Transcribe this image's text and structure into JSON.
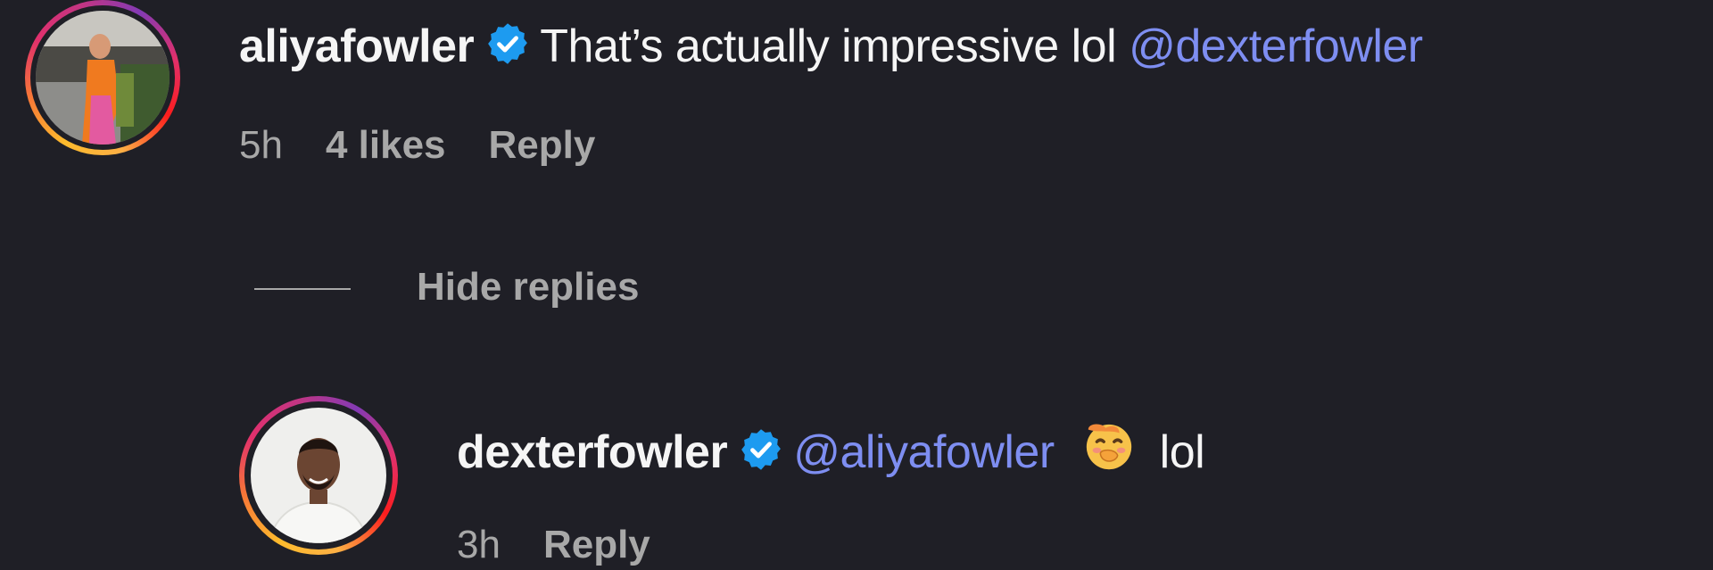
{
  "comments": [
    {
      "username": "aliyafowler",
      "verified": true,
      "text": "That’s actually impressive lol",
      "mention": "@dexterfowler",
      "time": "5h",
      "likes": "4 likes",
      "reply_label": "Reply"
    }
  ],
  "hide_replies_label": "Hide replies",
  "replies": [
    {
      "username": "dexterfowler",
      "verified": true,
      "mention": "@aliyafowler",
      "emoji": "smiling-face-with-hand-over-mouth",
      "text": "lol",
      "time": "3h",
      "reply_label": "Reply"
    }
  ],
  "colors": {
    "background": "#1f1f26",
    "mention": "#7e8ef1",
    "verified": "#1d9bf0",
    "meta_text": "#a8a8a8"
  }
}
